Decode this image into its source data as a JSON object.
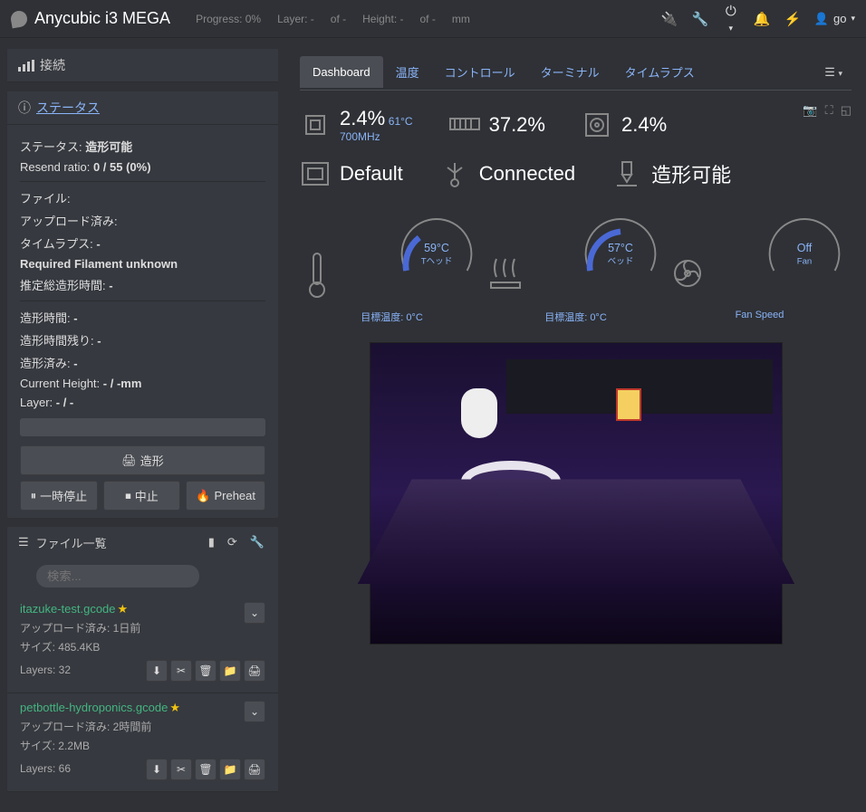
{
  "header": {
    "title": "Anycubic i3 MEGA",
    "progress_label": "Progress: 0%",
    "layer_label": "Layer: -",
    "layer_of": "of -",
    "height_label": "Height: -",
    "height_of": "of -",
    "height_unit": "mm",
    "user": "go"
  },
  "sidebar": {
    "connection": {
      "title": "接続"
    },
    "status": {
      "title": "ステータス",
      "state_label": "ステータス:",
      "state_value": "造形可能",
      "resend_label": "Resend ratio:",
      "resend_value": "0 / 55 (0%)",
      "file_label": "ファイル:",
      "uploaded_label": "アップロード済み:",
      "timelapse_label": "タイムラプス:",
      "timelapse_value": "-",
      "filament_label": "Required Filament unknown",
      "esttime_label": "推定総造形時間:",
      "esttime_value": "-",
      "printtime_label": "造形時間:",
      "printtime_value": "-",
      "printleft_label": "造形時間残り:",
      "printleft_value": "-",
      "printed_label": "造形済み:",
      "printed_value": "-",
      "curheight_label": "Current Height:",
      "curheight_value": "- / -mm",
      "lay_label": "Layer:",
      "lay_value": "- / -"
    },
    "buttons": {
      "print": "造形",
      "pause": "一時停止",
      "stop": "中止",
      "preheat": "Preheat"
    },
    "files": {
      "title": "ファイル一覧",
      "search_placeholder": "検索...",
      "items": [
        {
          "name": "itazuke-test.gcode",
          "uploaded_label": "アップロード済み: 1日前",
          "size_label": "サイズ: 485.4KB",
          "layers_label": "Layers: 32"
        },
        {
          "name": "petbottle-hydroponics.gcode",
          "uploaded_label": "アップロード済み: 2時間前",
          "size_label": "サイズ: 2.2MB",
          "layers_label": "Layers: 66"
        }
      ]
    }
  },
  "tabs": {
    "dashboard": "Dashboard",
    "temp": "温度",
    "control": "コントロール",
    "terminal": "ターミナル",
    "timelapse": "タイムラプス"
  },
  "dash": {
    "cpu_pct": "2.4%",
    "cpu_temp": "61°C",
    "cpu_freq": "700MHz",
    "mem_pct": "37.2%",
    "disk_pct": "2.4%",
    "profile": "Default",
    "conn": "Connected",
    "status": "造形可能",
    "g_tool_val": "59°C",
    "g_tool_lbl": "Tヘッド",
    "g_tool_target": "目標温度: 0°C",
    "g_bed_val": "57°C",
    "g_bed_lbl": "ベッド",
    "g_bed_target": "目標温度: 0°C",
    "g_fan_val": "Off",
    "g_fan_lbl": "Fan",
    "g_fan_target": "Fan Speed"
  }
}
